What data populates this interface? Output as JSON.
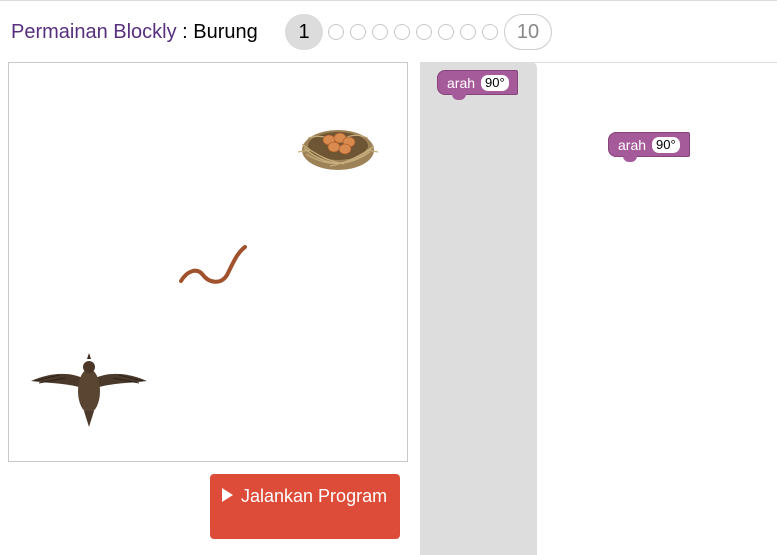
{
  "header": {
    "app_name": "Permainan Blockly",
    "separator": " : ",
    "game_name": "Burung"
  },
  "levels": {
    "current": "1",
    "last": "10",
    "dots_between": 8
  },
  "game": {
    "objects": [
      "nest-with-eggs",
      "worm",
      "bird"
    ]
  },
  "run_button": {
    "label": "Jalankan Program"
  },
  "toolbox": {
    "blocks": [
      {
        "label": "arah",
        "value": "90°"
      }
    ]
  },
  "workspace": {
    "blocks": [
      {
        "label": "arah",
        "value": "90°"
      }
    ]
  },
  "colors": {
    "title_link": "#572f7e",
    "level_current_bg": "#dcdcdc",
    "run_button_bg": "#dd4b39",
    "block_color": "#a55b99",
    "toolbox_bg": "#dddddd"
  }
}
